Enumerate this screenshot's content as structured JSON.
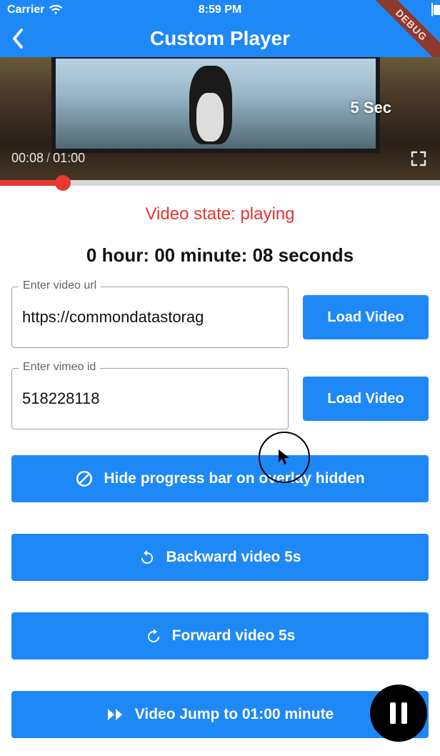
{
  "status": {
    "carrier": "Carrier",
    "time": "8:59 PM"
  },
  "nav": {
    "title": "Custom Player",
    "debug": "DEBUG"
  },
  "video": {
    "seek_hint": "5 Sec",
    "elapsed": "00:08",
    "duration": "01:00"
  },
  "state": {
    "label": "Video state: playing"
  },
  "timestamp": {
    "label": "0 hour: 00 minute: 08 seconds"
  },
  "url_field": {
    "label": "Enter video url",
    "value": "https://commondatastorag",
    "button": "Load Video"
  },
  "vimeo_field": {
    "label": "Enter vimeo id",
    "value": "518228118",
    "button": "Load Video"
  },
  "buttons": {
    "hide_progress": "Hide progress bar on overlay hidden",
    "backward": "Backward video 5s",
    "forward": "Forward video 5s",
    "jump": "Video Jump to 01:00 minute"
  }
}
